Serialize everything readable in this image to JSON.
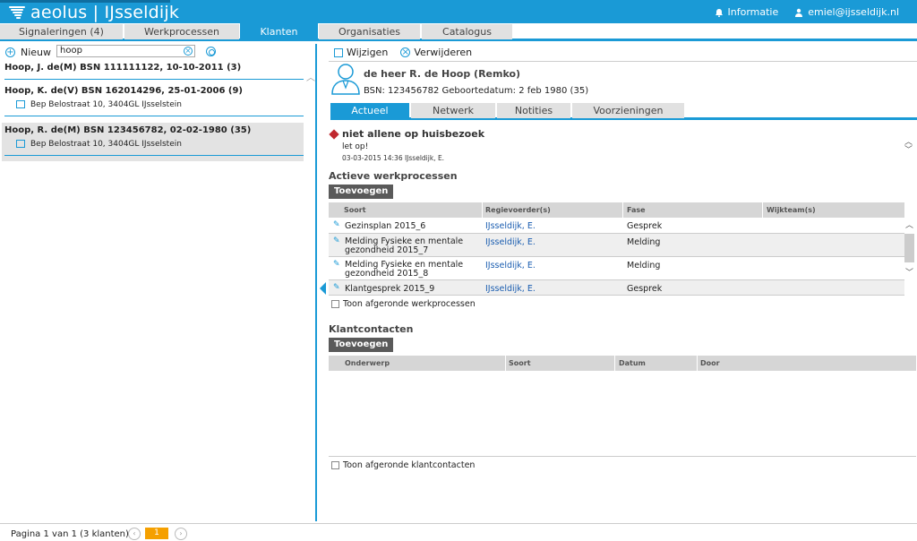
{
  "app": {
    "title": "aeolus | IJsseldijk",
    "info_label": "Informatie",
    "user_email": "emiel@ijsseldijk.nl"
  },
  "main_tabs": [
    {
      "label": "Signaleringen (4)"
    },
    {
      "label": "Werkprocessen"
    },
    {
      "label": "Klanten"
    },
    {
      "label": "Organisaties"
    },
    {
      "label": "Catalogus"
    }
  ],
  "left": {
    "new_label": "Nieuw",
    "search_value": "hoop",
    "clients": [
      {
        "name": "Hoop, J. de(M) BSN 111111122, 10-10-2011 (3)",
        "address": ""
      },
      {
        "name": "Hoop, K. de(V) BSN 162014296, 25-01-2006 (9)",
        "address": "Bep Belostraat 10, 3404GL IJsselstein"
      },
      {
        "name": "Hoop, R. de(M) BSN 123456782, 02-02-1980 (35)",
        "address": "Bep Belostraat 10, 3404GL IJsselstein"
      }
    ]
  },
  "footer": {
    "pagination_text": "Pagina 1 van 1 (3 klanten)",
    "current_page": "1"
  },
  "detail": {
    "edit_label": "Wijzigen",
    "delete_label": "Verwijderen",
    "person_name": "de heer R. de Hoop (Remko)",
    "person_sub": "BSN: 123456782  Geboortedatum: 2 feb 1980 (35)",
    "tabs": [
      {
        "label": "Actueel"
      },
      {
        "label": "Netwerk"
      },
      {
        "label": "Notities"
      },
      {
        "label": "Voorzieningen"
      }
    ],
    "alert": {
      "title": "niet allene op huisbezoek",
      "message": "let op!",
      "timestamp": "03-03-2015 14:36 IJsseldijk, E."
    },
    "workprocesses": {
      "title": "Actieve werkprocessen",
      "add_label": "Toevoegen",
      "columns": [
        "Soort",
        "Regievoerder(s)",
        "Fase",
        "Wijkteam(s)"
      ],
      "rows": [
        {
          "soort": "Gezinsplan 2015_6",
          "regie": "IJsseldijk, E.",
          "fase": "Gesprek",
          "wijkteam": ""
        },
        {
          "soort": "Melding Fysieke en mentale gezondheid 2015_7",
          "regie": "IJsseldijk, E.",
          "fase": "Melding",
          "wijkteam": ""
        },
        {
          "soort": "Melding Fysieke en mentale gezondheid 2015_8",
          "regie": "IJsseldijk, E.",
          "fase": "Melding",
          "wijkteam": ""
        },
        {
          "soort": "Klantgesprek 2015_9",
          "regie": "IJsseldijk, E.",
          "fase": "Gesprek",
          "wijkteam": ""
        }
      ],
      "show_finished_label": "Toon afgeronde werkprocessen"
    },
    "contacts": {
      "title": "Klantcontacten",
      "add_label": "Toevoegen",
      "columns": [
        "Onderwerp",
        "Soort",
        "Datum",
        "Door"
      ],
      "show_finished_label": "Toon afgeronde klantcontacten"
    }
  },
  "colors": {
    "accent": "#1a9ad6",
    "alert": "#c0282e",
    "page_active": "#f5a000"
  }
}
